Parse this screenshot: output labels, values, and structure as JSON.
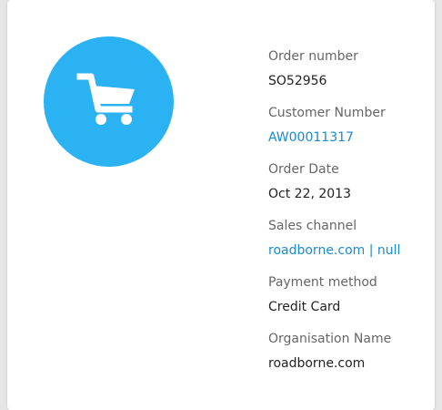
{
  "icon": {
    "name": "shopping-cart-icon",
    "circle_color": "#2bb2f2",
    "glyph_color": "#ffffff"
  },
  "fields": [
    {
      "label": "Order number",
      "value": "SO52956",
      "link": false
    },
    {
      "label": "Customer Number",
      "value": "AW00011317",
      "link": true
    },
    {
      "label": "Order Date",
      "value": "Oct 22, 2013",
      "link": false
    },
    {
      "label": "Sales channel",
      "value": "roadborne.com | null",
      "link": true
    },
    {
      "label": "Payment method",
      "value": "Credit Card",
      "link": false
    },
    {
      "label": "Organisation Name",
      "value": "roadborne.com",
      "link": false
    }
  ]
}
